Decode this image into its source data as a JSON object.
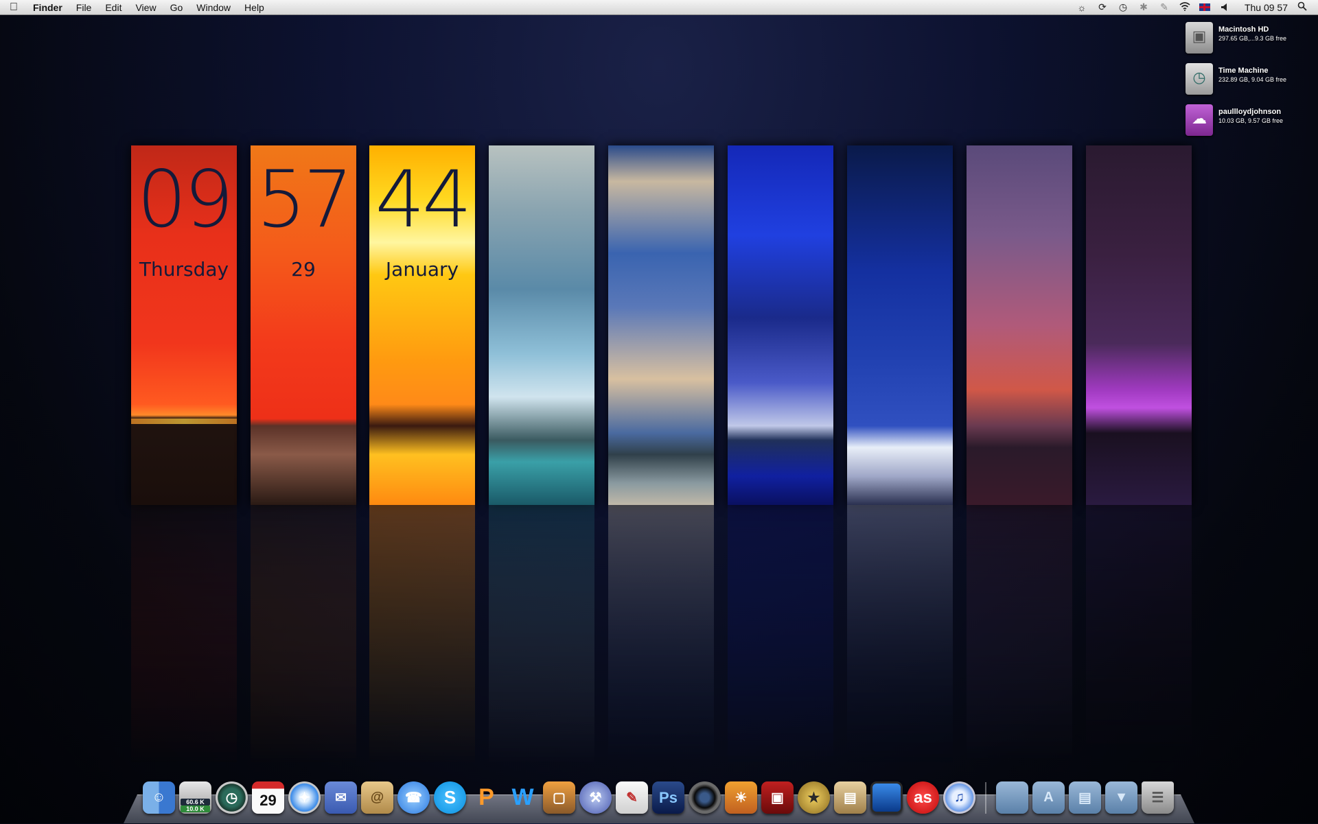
{
  "menubar": {
    "apple_icon": "apple-icon",
    "app_name": "Finder",
    "menus": [
      "File",
      "Edit",
      "View",
      "Go",
      "Window",
      "Help"
    ],
    "status_icons": [
      "brightness-icon",
      "sync-icon",
      "time-machine-icon",
      "bluetooth-icon",
      "pen-icon",
      "wifi-icon",
      "flag-uk-icon",
      "volume-icon"
    ],
    "clock": "Thu 09 57",
    "spotlight_icon": "search-icon"
  },
  "drives": [
    {
      "name": "Macintosh HD",
      "info": "297.65 GB,...9.3 GB free",
      "icon": "hard-drive-icon",
      "color": "#a9a9a9"
    },
    {
      "name": "Time Machine",
      "info": "232.89 GB, 9.04 GB free",
      "icon": "time-machine-icon",
      "color": "#3a6a68"
    },
    {
      "name": "paullloydjohnson",
      "info": "10.03 GB, 9.57 GB free",
      "icon": "cloud-icon",
      "color": "#9b3bb0"
    }
  ],
  "clock_widget": {
    "hours": "09",
    "minutes": "57",
    "seconds": "44",
    "day": "Thursday",
    "date": "29",
    "month": "January"
  },
  "dock": {
    "badge_top": "60.6 K",
    "badge_bottom": "10.0 K",
    "calendar_day": "29",
    "ps_label": "Ps",
    "items": [
      "finder-icon",
      "network-monitor-icon",
      "time-machine-icon",
      "ical-icon",
      "safari-icon",
      "mail-icon",
      "address-book-icon",
      "ichat-icon",
      "skype-icon",
      "pages-icon",
      "numbers-icon",
      "keynote-icon",
      "xcode-icon",
      "textedit-icon",
      "photoshop-icon",
      "camera-icon",
      "iphoto-icon",
      "photo-booth-icon",
      "imovie-icon",
      "front-row-icon",
      "tv-icon",
      "lastfm-icon",
      "itunes-icon",
      "folder-icon",
      "applications-folder-icon",
      "documents-folder-icon",
      "downloads-folder-icon",
      "trash-icon"
    ]
  }
}
